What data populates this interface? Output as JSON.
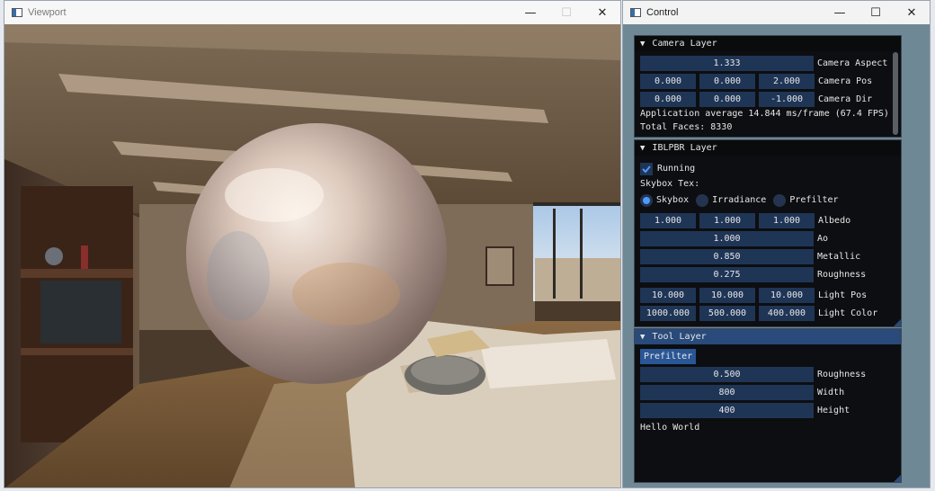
{
  "viewport": {
    "title": "Viewport",
    "minimize": "—",
    "maximize": "☐",
    "close": "✕"
  },
  "control": {
    "title": "Control",
    "minimize": "—",
    "maximize": "☐",
    "close": "✕"
  },
  "camera_layer": {
    "header": "Camera Layer",
    "arrow": "▼",
    "aspect": {
      "value": "1.333",
      "label": "Camera Aspect"
    },
    "pos": {
      "x": "0.000",
      "y": "0.000",
      "z": "2.000",
      "label": "Camera Pos"
    },
    "dir": {
      "x": "0.000",
      "y": "0.000",
      "z": "-1.000",
      "label": "Camera Dir"
    },
    "fps_text": "Application average 14.844 ms/frame (67.4 FPS)",
    "faces_text": "Total Faces: 8330"
  },
  "iblpbr_layer": {
    "header": "IBLPBR Layer",
    "arrow": "▼",
    "running_label": "Running",
    "running_checked": true,
    "skybox_tex_label": "Skybox Tex:",
    "radios": [
      {
        "label": "Skybox",
        "selected": true
      },
      {
        "label": "Irradiance",
        "selected": false
      },
      {
        "label": "Prefilter",
        "selected": false
      }
    ],
    "albedo": {
      "r": "1.000",
      "g": "1.000",
      "b": "1.000",
      "label": "Albedo"
    },
    "ao": {
      "value": "1.000",
      "label": "Ao"
    },
    "metallic": {
      "value": "0.850",
      "label": "Metallic"
    },
    "roughness": {
      "value": "0.275",
      "label": "Roughness"
    },
    "light_pos": {
      "x": "10.000",
      "y": "10.000",
      "z": "10.000",
      "label": "Light Pos"
    },
    "light_color": {
      "r": "1000.000",
      "g": "500.000",
      "b": "400.000",
      "label": "Light Color"
    }
  },
  "tool_layer": {
    "header": "Tool Layer",
    "arrow": "▼",
    "prefilter_button": "Prefilter",
    "roughness": {
      "value": "0.500",
      "label": "Roughness"
    },
    "width": {
      "value": "800",
      "label": "Width"
    },
    "height": {
      "value": "400",
      "label": "Height"
    },
    "hello": "Hello World"
  },
  "colors": {
    "panel_bg": "#0d0e11",
    "field_bg": "#1f3556",
    "active_header": "#294a7a",
    "button": "#2a5696",
    "check_accent": "#4c9aff"
  },
  "icons": {
    "app": "window-app-icon",
    "check": "checkmark-icon",
    "collapse": "collapse-arrow-icon"
  }
}
